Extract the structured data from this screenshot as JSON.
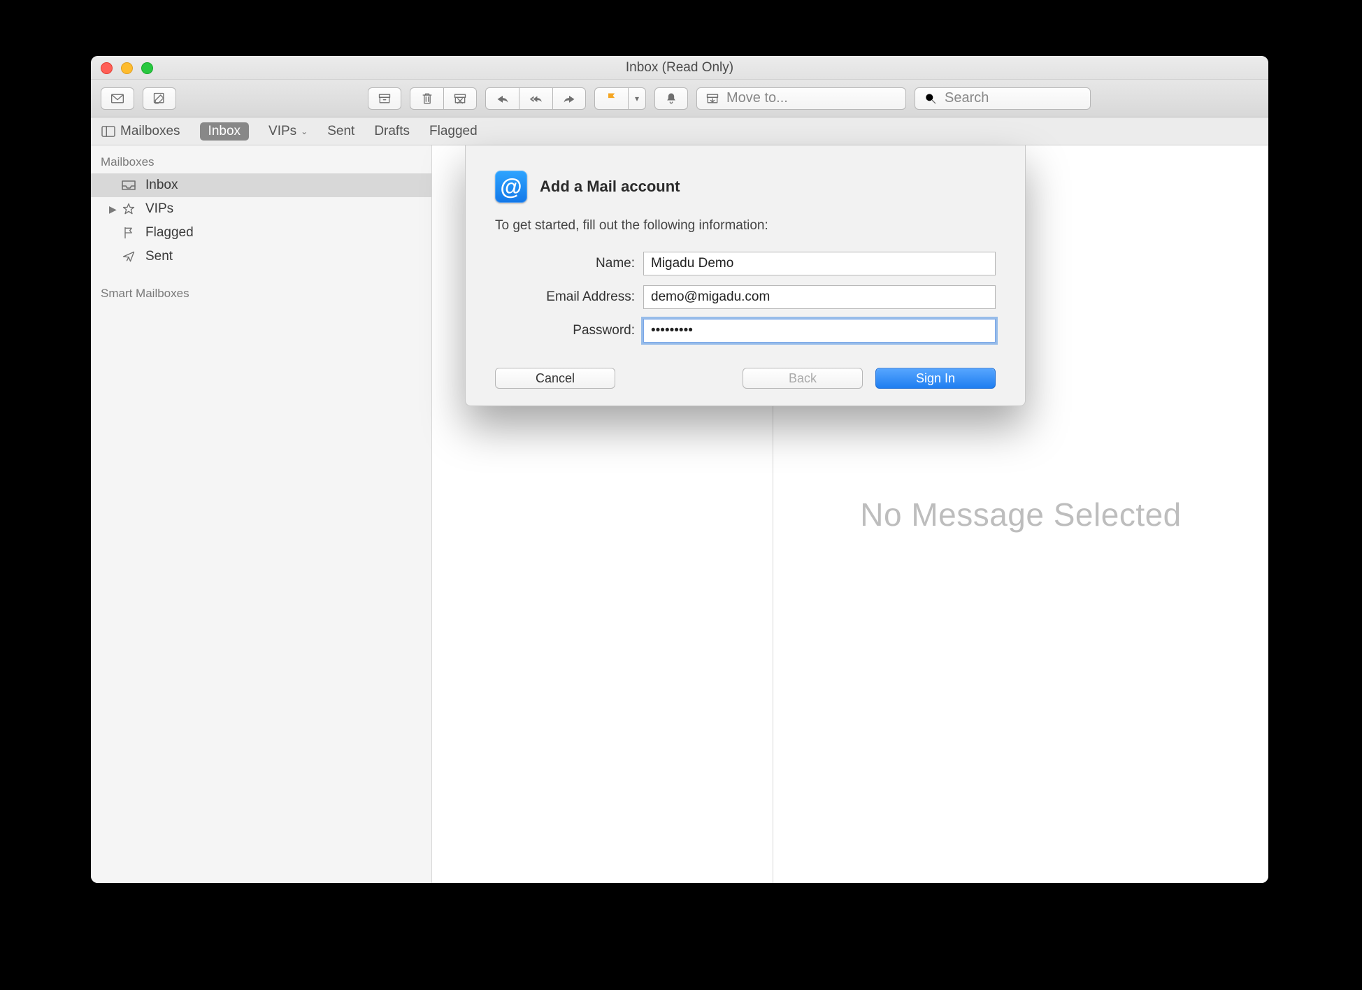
{
  "window": {
    "title": "Inbox (Read Only)"
  },
  "toolbar": {
    "move_placeholder": "Move to...",
    "search_placeholder": "Search"
  },
  "favbar": {
    "mailboxes": "Mailboxes",
    "inbox": "Inbox",
    "vips": "VIPs",
    "sent": "Sent",
    "drafts": "Drafts",
    "flagged": "Flagged"
  },
  "sidebar": {
    "heading_mailboxes": "Mailboxes",
    "inbox": "Inbox",
    "vips": "VIPs",
    "flagged": "Flagged",
    "sent": "Sent",
    "heading_smart": "Smart Mailboxes"
  },
  "content": {
    "no_message": "No Message Selected"
  },
  "sheet": {
    "icon_glyph": "@",
    "title": "Add a Mail account",
    "desc": "To get started, fill out the following information:",
    "name_label": "Name:",
    "name_value": "Migadu Demo",
    "email_label": "Email Address:",
    "email_value": "demo@migadu.com",
    "password_label": "Password:",
    "password_value": "•••••••••",
    "cancel": "Cancel",
    "back": "Back",
    "signin": "Sign In"
  }
}
